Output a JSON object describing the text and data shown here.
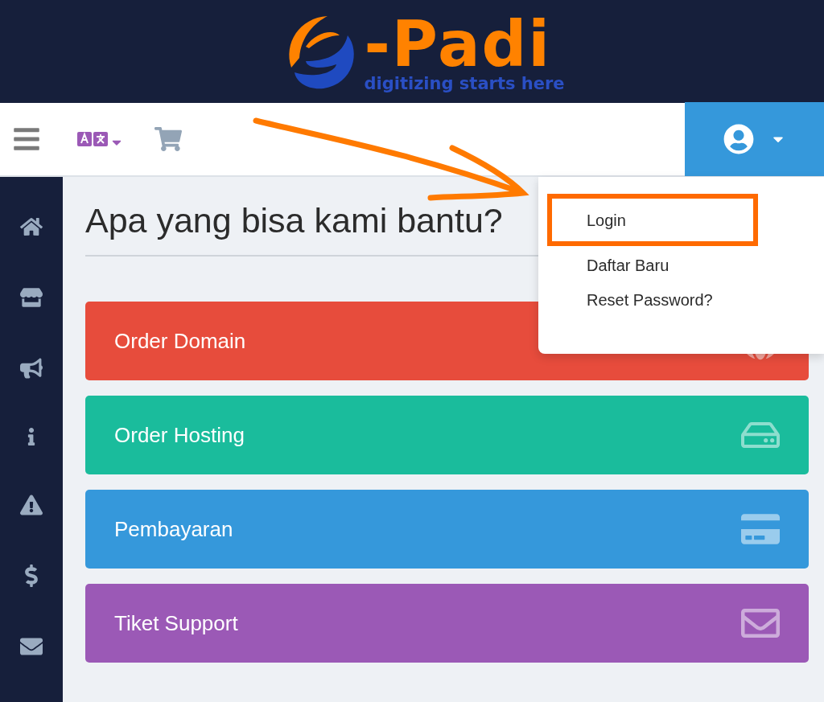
{
  "logo": {
    "wordmark": "-Padi",
    "tagline": "digitizing starts here"
  },
  "heading": "Apa yang bisa kami bantu?",
  "cards": [
    {
      "label": "Order Domain",
      "color": "#e74c3c"
    },
    {
      "label": "Order Hosting",
      "color": "#1abc9c"
    },
    {
      "label": "Pembayaran",
      "color": "#3598db"
    },
    {
      "label": "Tiket Support",
      "color": "#9b59b6"
    }
  ],
  "user_menu": {
    "expanded": true,
    "items": [
      {
        "label": "Login",
        "highlighted": true
      },
      {
        "label": "Daftar Baru",
        "highlighted": false
      },
      {
        "label": "Reset Password?",
        "highlighted": false
      }
    ]
  }
}
